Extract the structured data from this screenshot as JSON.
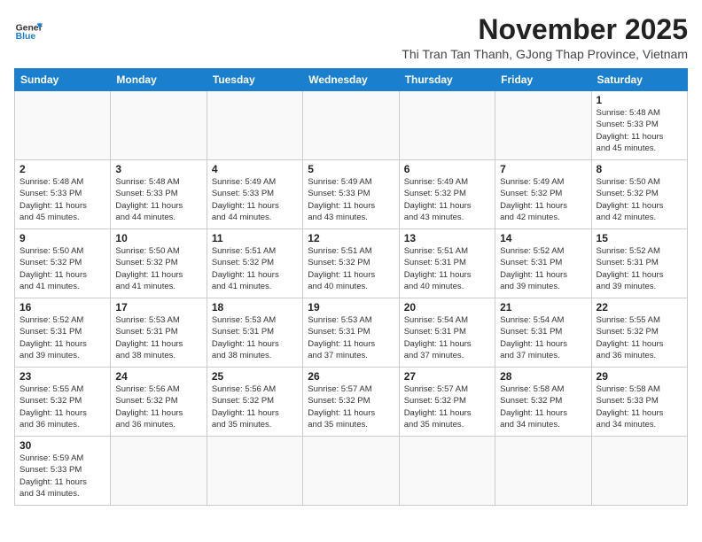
{
  "header": {
    "logo_line1": "General",
    "logo_line2": "Blue",
    "month_title": "November 2025",
    "subtitle": "Thi Tran Tan Thanh, GJong Thap Province, Vietnam"
  },
  "weekdays": [
    "Sunday",
    "Monday",
    "Tuesday",
    "Wednesday",
    "Thursday",
    "Friday",
    "Saturday"
  ],
  "days": [
    {
      "num": "",
      "info": ""
    },
    {
      "num": "",
      "info": ""
    },
    {
      "num": "",
      "info": ""
    },
    {
      "num": "",
      "info": ""
    },
    {
      "num": "",
      "info": ""
    },
    {
      "num": "",
      "info": ""
    },
    {
      "num": "1",
      "info": "Sunrise: 5:48 AM\nSunset: 5:33 PM\nDaylight: 11 hours\nand 45 minutes."
    },
    {
      "num": "2",
      "info": "Sunrise: 5:48 AM\nSunset: 5:33 PM\nDaylight: 11 hours\nand 45 minutes."
    },
    {
      "num": "3",
      "info": "Sunrise: 5:48 AM\nSunset: 5:33 PM\nDaylight: 11 hours\nand 44 minutes."
    },
    {
      "num": "4",
      "info": "Sunrise: 5:49 AM\nSunset: 5:33 PM\nDaylight: 11 hours\nand 44 minutes."
    },
    {
      "num": "5",
      "info": "Sunrise: 5:49 AM\nSunset: 5:33 PM\nDaylight: 11 hours\nand 43 minutes."
    },
    {
      "num": "6",
      "info": "Sunrise: 5:49 AM\nSunset: 5:32 PM\nDaylight: 11 hours\nand 43 minutes."
    },
    {
      "num": "7",
      "info": "Sunrise: 5:49 AM\nSunset: 5:32 PM\nDaylight: 11 hours\nand 42 minutes."
    },
    {
      "num": "8",
      "info": "Sunrise: 5:50 AM\nSunset: 5:32 PM\nDaylight: 11 hours\nand 42 minutes."
    },
    {
      "num": "9",
      "info": "Sunrise: 5:50 AM\nSunset: 5:32 PM\nDaylight: 11 hours\nand 41 minutes."
    },
    {
      "num": "10",
      "info": "Sunrise: 5:50 AM\nSunset: 5:32 PM\nDaylight: 11 hours\nand 41 minutes."
    },
    {
      "num": "11",
      "info": "Sunrise: 5:51 AM\nSunset: 5:32 PM\nDaylight: 11 hours\nand 41 minutes."
    },
    {
      "num": "12",
      "info": "Sunrise: 5:51 AM\nSunset: 5:32 PM\nDaylight: 11 hours\nand 40 minutes."
    },
    {
      "num": "13",
      "info": "Sunrise: 5:51 AM\nSunset: 5:31 PM\nDaylight: 11 hours\nand 40 minutes."
    },
    {
      "num": "14",
      "info": "Sunrise: 5:52 AM\nSunset: 5:31 PM\nDaylight: 11 hours\nand 39 minutes."
    },
    {
      "num": "15",
      "info": "Sunrise: 5:52 AM\nSunset: 5:31 PM\nDaylight: 11 hours\nand 39 minutes."
    },
    {
      "num": "16",
      "info": "Sunrise: 5:52 AM\nSunset: 5:31 PM\nDaylight: 11 hours\nand 39 minutes."
    },
    {
      "num": "17",
      "info": "Sunrise: 5:53 AM\nSunset: 5:31 PM\nDaylight: 11 hours\nand 38 minutes."
    },
    {
      "num": "18",
      "info": "Sunrise: 5:53 AM\nSunset: 5:31 PM\nDaylight: 11 hours\nand 38 minutes."
    },
    {
      "num": "19",
      "info": "Sunrise: 5:53 AM\nSunset: 5:31 PM\nDaylight: 11 hours\nand 37 minutes."
    },
    {
      "num": "20",
      "info": "Sunrise: 5:54 AM\nSunset: 5:31 PM\nDaylight: 11 hours\nand 37 minutes."
    },
    {
      "num": "21",
      "info": "Sunrise: 5:54 AM\nSunset: 5:31 PM\nDaylight: 11 hours\nand 37 minutes."
    },
    {
      "num": "22",
      "info": "Sunrise: 5:55 AM\nSunset: 5:32 PM\nDaylight: 11 hours\nand 36 minutes."
    },
    {
      "num": "23",
      "info": "Sunrise: 5:55 AM\nSunset: 5:32 PM\nDaylight: 11 hours\nand 36 minutes."
    },
    {
      "num": "24",
      "info": "Sunrise: 5:56 AM\nSunset: 5:32 PM\nDaylight: 11 hours\nand 36 minutes."
    },
    {
      "num": "25",
      "info": "Sunrise: 5:56 AM\nSunset: 5:32 PM\nDaylight: 11 hours\nand 35 minutes."
    },
    {
      "num": "26",
      "info": "Sunrise: 5:57 AM\nSunset: 5:32 PM\nDaylight: 11 hours\nand 35 minutes."
    },
    {
      "num": "27",
      "info": "Sunrise: 5:57 AM\nSunset: 5:32 PM\nDaylight: 11 hours\nand 35 minutes."
    },
    {
      "num": "28",
      "info": "Sunrise: 5:58 AM\nSunset: 5:32 PM\nDaylight: 11 hours\nand 34 minutes."
    },
    {
      "num": "29",
      "info": "Sunrise: 5:58 AM\nSunset: 5:33 PM\nDaylight: 11 hours\nand 34 minutes."
    },
    {
      "num": "30",
      "info": "Sunrise: 5:59 AM\nSunset: 5:33 PM\nDaylight: 11 hours\nand 34 minutes."
    },
    {
      "num": "",
      "info": ""
    },
    {
      "num": "",
      "info": ""
    },
    {
      "num": "",
      "info": ""
    },
    {
      "num": "",
      "info": ""
    },
    {
      "num": "",
      "info": ""
    },
    {
      "num": "",
      "info": ""
    }
  ]
}
